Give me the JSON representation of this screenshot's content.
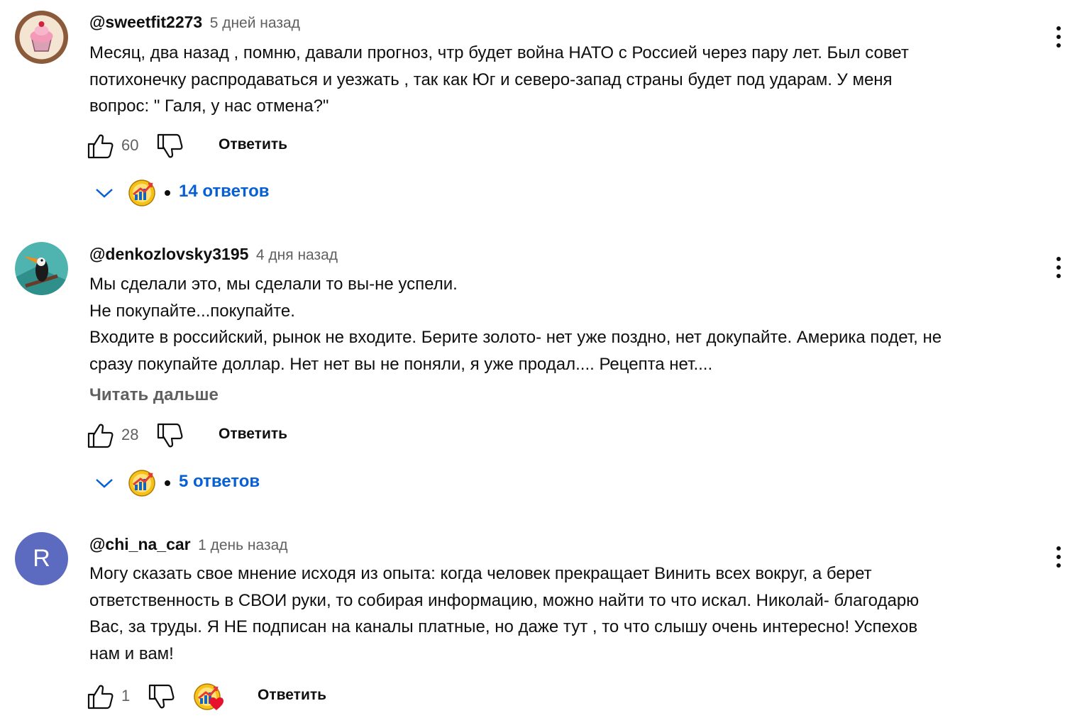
{
  "comments": [
    {
      "author": "@sweetfit2273",
      "time": "5 дней назад",
      "avatar_icon": "cupcake-avatar",
      "lines": [
        "Месяц, два назад , помню, давали прогноз, чтр будет война НАТО с Россией через пару лет. Был совет",
        "потихонечку распродаваться и уезжать , так как Юг и северо-запад страны будет под ударам. У меня",
        "вопрос: \" Галя, у нас отмена?\""
      ],
      "likes": "60",
      "reply_label": "Ответить",
      "replies_label": "14 ответов"
    },
    {
      "author": "@denkozlovsky3195",
      "time": "4 дня назад",
      "avatar_icon": "toucan-avatar",
      "lines": [
        "Мы сделали это, мы сделали то вы-не успели.",
        "Не покупайте...покупайте.",
        "Входите в российский, рынок не входите. Берите золото- нет уже поздно, нет докупайте. Америка подет, не",
        "сразу покупайте доллар. Нет нет вы не поняли, я уже продал.... Рецепта нет...."
      ],
      "read_more": "Читать дальше",
      "likes": "28",
      "reply_label": "Ответить",
      "replies_label": "5 ответов"
    },
    {
      "author": "@chi_na_car",
      "time": "1 день назад",
      "avatar_letter": "R",
      "avatar_color": "#5c6bc0",
      "lines": [
        "Могу сказать свое мнение исходя из опыта: когда человек прекращает Винить всех вокруг, а берет",
        "ответственность в СВОИ руки, то собирая информацию, можно найти то что искал. Николай- благодарю",
        "Вас, за труды. Я НЕ подписан на каналы платные, но даже тут , то что слышу очень интересно! Успехов",
        "нам и вам!"
      ],
      "likes": "1",
      "reply_label": "Ответить"
    }
  ],
  "colors": {
    "link": "#065fd4",
    "secondary": "#606060",
    "heart": "#e8112d"
  }
}
